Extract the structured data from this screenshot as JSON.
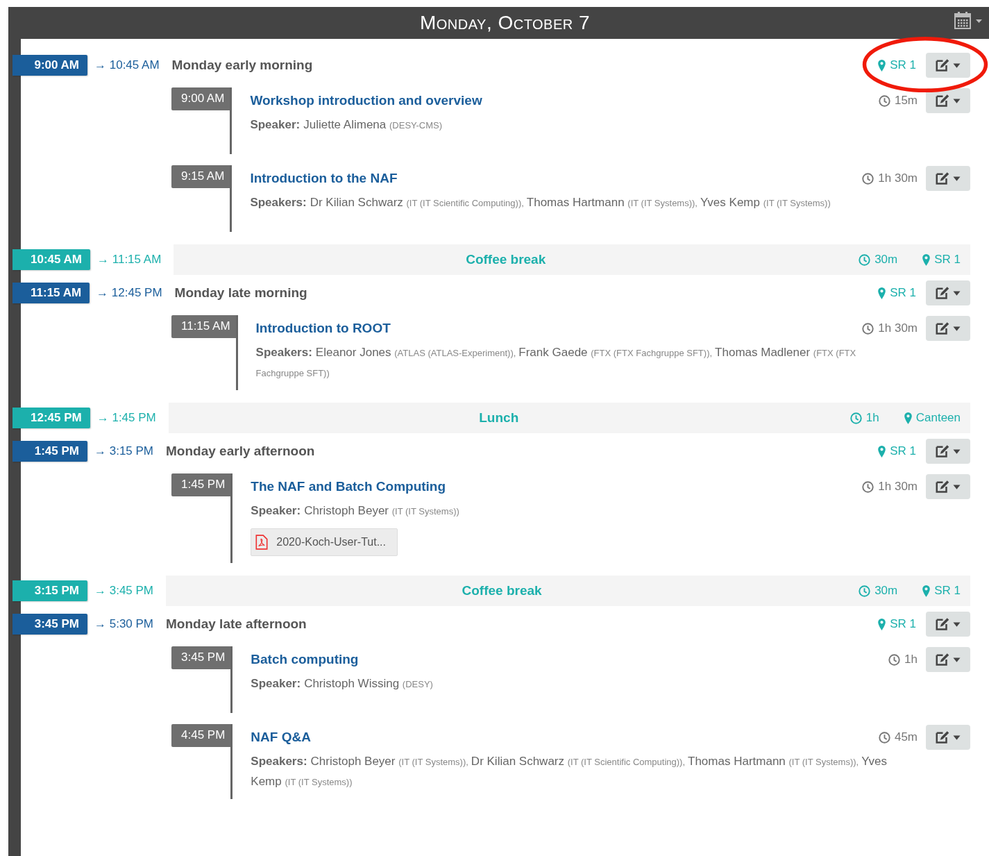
{
  "header": {
    "title": "Monday, October 7"
  },
  "entries": [
    {
      "kind": "session",
      "start": "9:00 AM",
      "end": "→ 10:45 AM",
      "title": "Monday early morning",
      "location": "SR 1",
      "contributions": [
        {
          "time": "9:00 AM",
          "title": "Workshop introduction and overview",
          "duration": "15m",
          "speaker_label": "Speaker:",
          "speakers": [
            {
              "name": "Juliette Alimena",
              "affiliation": "(DESY-CMS)"
            }
          ]
        },
        {
          "time": "9:15 AM",
          "title": "Introduction to the NAF",
          "duration": "1h 30m",
          "speaker_label": "Speakers:",
          "speakers": [
            {
              "name": "Dr Kilian Schwarz",
              "affiliation": "(IT (IT Scientific Computing)),"
            },
            {
              "name": "Thomas Hartmann",
              "affiliation": "(IT (IT Systems)),"
            },
            {
              "name": "Yves Kemp",
              "affiliation": "(IT (IT Systems))"
            }
          ]
        }
      ]
    },
    {
      "kind": "break",
      "start": "10:45 AM",
      "end": "→ 11:15 AM",
      "title": "Coffee break",
      "duration": "30m",
      "location": "SR 1"
    },
    {
      "kind": "session",
      "start": "11:15 AM",
      "end": "→ 12:45 PM",
      "title": "Monday late morning",
      "location": "SR 1",
      "contributions": [
        {
          "time": "11:15 AM",
          "title": "Introduction to ROOT",
          "duration": "1h 30m",
          "speaker_label": "Speakers:",
          "speakers": [
            {
              "name": "Eleanor Jones",
              "affiliation": "(ATLAS (ATLAS-Experiment)),"
            },
            {
              "name": "Frank Gaede",
              "affiliation": "(FTX (FTX Fachgruppe SFT)),"
            },
            {
              "name": "Thomas Madlener",
              "affiliation": "(FTX (FTX Fachgruppe SFT))"
            }
          ]
        }
      ]
    },
    {
      "kind": "break",
      "start": "12:45 PM",
      "end": "→ 1:45 PM",
      "title": "Lunch",
      "duration": "1h",
      "location": "Canteen"
    },
    {
      "kind": "session",
      "start": "1:45 PM",
      "end": "→ 3:15 PM",
      "title": "Monday early afternoon",
      "location": "SR 1",
      "contributions": [
        {
          "time": "1:45 PM",
          "title": "The NAF and Batch Computing",
          "duration": "1h 30m",
          "speaker_label": "Speaker:",
          "speakers": [
            {
              "name": "Christoph Beyer",
              "affiliation": "(IT (IT Systems))"
            }
          ],
          "attachments": [
            "2020-Koch-User-Tut..."
          ]
        }
      ]
    },
    {
      "kind": "break",
      "start": "3:15 PM",
      "end": "→ 3:45 PM",
      "title": "Coffee break",
      "duration": "30m",
      "location": "SR 1"
    },
    {
      "kind": "session",
      "start": "3:45 PM",
      "end": "→ 5:30 PM",
      "title": "Monday late afternoon",
      "location": "SR 1",
      "contributions": [
        {
          "time": "3:45 PM",
          "title": "Batch computing",
          "duration": "1h",
          "speaker_label": "Speaker:",
          "speakers": [
            {
              "name": "Christoph Wissing",
              "affiliation": "(DESY)"
            }
          ]
        },
        {
          "time": "4:45 PM",
          "title": "NAF Q&A",
          "duration": "45m",
          "speaker_label": "Speakers:",
          "speakers": [
            {
              "name": "Christoph Beyer",
              "affiliation": "(IT (IT Systems)),"
            },
            {
              "name": "Dr Kilian Schwarz",
              "affiliation": "(IT (IT Scientific Computing)),"
            },
            {
              "name": "Thomas Hartmann",
              "affiliation": "(IT (IT Systems)),"
            },
            {
              "name": "Yves Kemp",
              "affiliation": "(IT (IT Systems))"
            }
          ]
        }
      ]
    }
  ]
}
